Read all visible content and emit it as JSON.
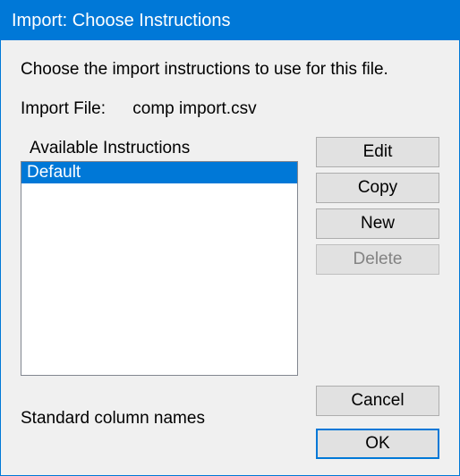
{
  "window": {
    "title": "Import: Choose Instructions"
  },
  "content": {
    "instruction_text": "Choose the import instructions to use for this file.",
    "file_label": "Import File:",
    "file_name": "comp import.csv",
    "list_header": "Available Instructions",
    "list_items": [
      {
        "label": "Default",
        "selected": true
      }
    ],
    "status_text": "Standard column names"
  },
  "buttons": {
    "edit": "Edit",
    "copy": "Copy",
    "new": "New",
    "delete": "Delete",
    "cancel": "Cancel",
    "ok": "OK"
  }
}
